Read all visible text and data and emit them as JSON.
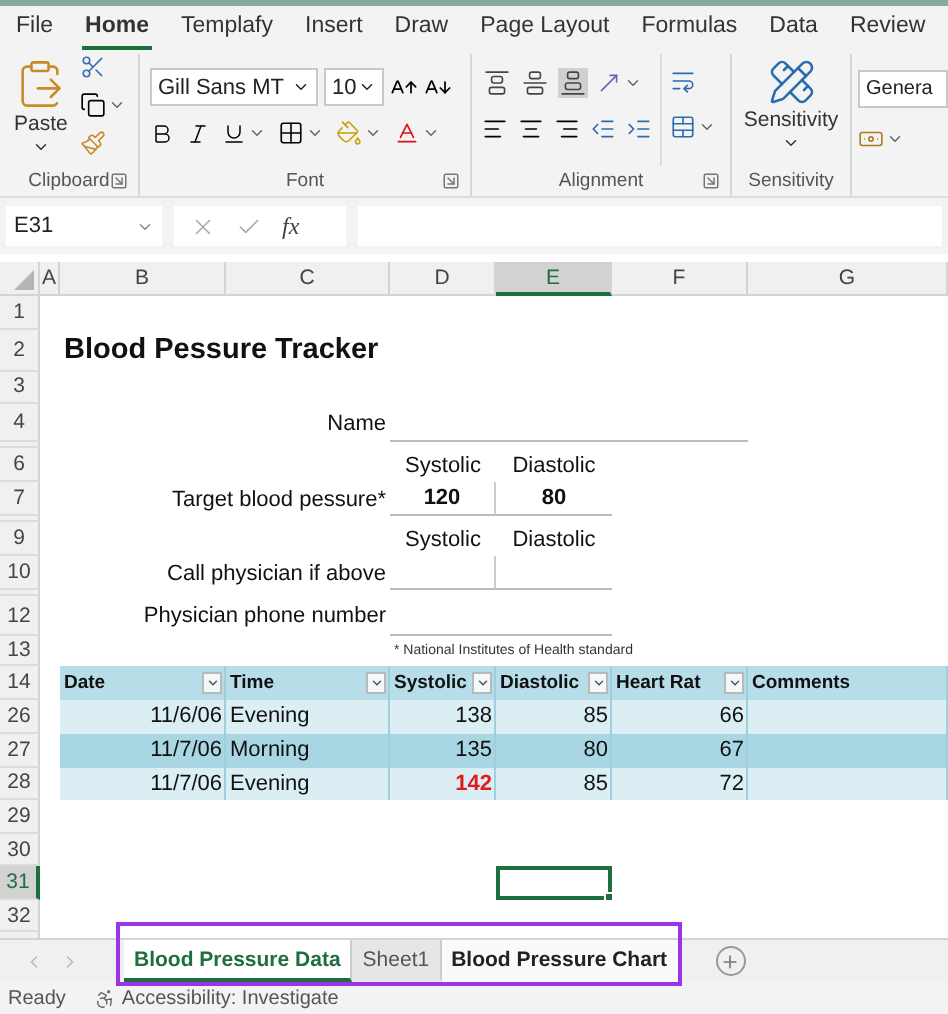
{
  "menu_tabs": [
    {
      "label": "File",
      "selected": false
    },
    {
      "label": "Home",
      "selected": true
    },
    {
      "label": "Templafy",
      "selected": false
    },
    {
      "label": "Insert",
      "selected": false
    },
    {
      "label": "Draw",
      "selected": false
    },
    {
      "label": "Page Layout",
      "selected": false
    },
    {
      "label": "Formulas",
      "selected": false
    },
    {
      "label": "Data",
      "selected": false
    },
    {
      "label": "Review",
      "selected": false
    }
  ],
  "ribbon": {
    "clipboard": {
      "paste": "Paste",
      "label": "Clipboard"
    },
    "font": {
      "name": "Gill Sans MT",
      "size": "10",
      "label": "Font"
    },
    "alignment": {
      "label": "Alignment"
    },
    "sensitivity": {
      "button": "Sensitivity",
      "label": "Sensitivity"
    },
    "number": {
      "format": "Genera"
    }
  },
  "formula_bar": {
    "name_box": "E31",
    "fx": "fx"
  },
  "columns": [
    {
      "label": "A",
      "selected": false
    },
    {
      "label": "B",
      "selected": false
    },
    {
      "label": "C",
      "selected": false
    },
    {
      "label": "D",
      "selected": false
    },
    {
      "label": "E",
      "selected": true
    },
    {
      "label": "F",
      "selected": false
    },
    {
      "label": "G",
      "selected": false
    }
  ],
  "rows": [
    {
      "kind": "blank",
      "number": "1",
      "selected": false
    },
    {
      "kind": "title",
      "number": "2",
      "selected": false,
      "text": "Blood Pessure Tracker"
    },
    {
      "kind": "blank",
      "number": "3",
      "selected": false
    },
    {
      "kind": "field",
      "number": "4",
      "selected": false,
      "label": "Name"
    },
    {
      "kind": "collapsed"
    },
    {
      "kind": "pair_header",
      "number": "6",
      "selected": false,
      "systolic": "Systolic",
      "diastolic": "Diastolic"
    },
    {
      "kind": "pair_values",
      "number": "7",
      "selected": false,
      "label": "Target blood pessure*",
      "systolic": "120",
      "diastolic": "80"
    },
    {
      "kind": "collapsed"
    },
    {
      "kind": "pair_header",
      "number": "9",
      "selected": false,
      "systolic": "Systolic",
      "diastolic": "Diastolic"
    },
    {
      "kind": "pair_values",
      "number": "10",
      "selected": false,
      "label": "Call physician if above"
    },
    {
      "kind": "collapsed"
    },
    {
      "kind": "short_field",
      "number": "12",
      "selected": false,
      "label": "Physician phone number"
    },
    {
      "kind": "note",
      "number": "13",
      "selected": false,
      "text": "* National Institutes of Health standard"
    },
    {
      "kind": "table_header",
      "number": "14",
      "selected": false,
      "columns": [
        "Date",
        "Time",
        "Systolic",
        "Diastolic",
        "Heart Rat",
        "Comments"
      ]
    },
    {
      "kind": "table_row",
      "number": "26",
      "selected": false,
      "banded": false,
      "date": "11/6/06",
      "time": "Evening",
      "systolic": "138",
      "systolic_alert": false,
      "diastolic": "85",
      "heart_rate": "66"
    },
    {
      "kind": "table_row",
      "number": "27",
      "selected": false,
      "banded": true,
      "date": "11/7/06",
      "time": "Morning",
      "systolic": "135",
      "systolic_alert": false,
      "diastolic": "80",
      "heart_rate": "67"
    },
    {
      "kind": "table_row",
      "number": "28",
      "selected": false,
      "banded": false,
      "date": "11/7/06",
      "time": "Evening",
      "systolic": "142",
      "systolic_alert": true,
      "diastolic": "85",
      "heart_rate": "72"
    },
    {
      "kind": "blank",
      "number": "29",
      "selected": false
    },
    {
      "kind": "blank",
      "number": "30",
      "selected": false
    },
    {
      "kind": "blank",
      "number": "31",
      "selected": true
    },
    {
      "kind": "blank",
      "number": "32",
      "selected": false
    }
  ],
  "sheet_tabs": [
    {
      "label": "Blood Pressure Data",
      "selected": true
    },
    {
      "label": "Sheet1",
      "selected": false
    },
    {
      "label": "Blood Pressure Chart",
      "selected": false
    }
  ],
  "status_bar": {
    "mode": "Ready",
    "accessibility": "Accessibility: Investigate"
  }
}
